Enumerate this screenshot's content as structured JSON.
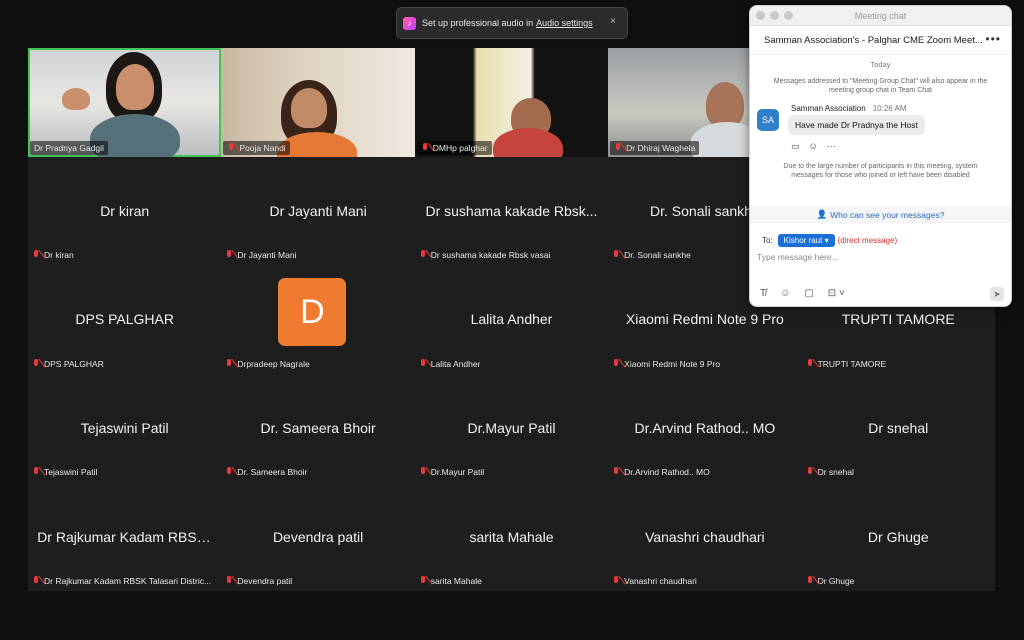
{
  "toast": {
    "icon": "music-note-icon",
    "text": "Set up professional audio in",
    "link": "Audio settings",
    "close": "×"
  },
  "gallery": {
    "tiles": [
      {
        "name": "Dr Pradnya Gadgil",
        "video": true,
        "active": true
      },
      {
        "name": "Pooja Nandi",
        "video": true
      },
      {
        "name": "DMHp palghar",
        "video": true
      },
      {
        "name": "Dr Dhiraj Waghela",
        "video": true
      },
      {
        "name": "",
        "hidden": true
      },
      {
        "name": "Dr kiran",
        "display": "Dr kiran"
      },
      {
        "name": "Dr Jayanti Mani",
        "display": "Dr Jayanti Mani"
      },
      {
        "name": "Dr sushama  kakade Rbsk vasai",
        "display": "Dr sushama  kakade Rbsk..."
      },
      {
        "name": "Dr. Sonali sankhe",
        "display": "Dr. Sonali sankhe"
      },
      {
        "name": "",
        "hidden": true
      },
      {
        "name": "DPS PALGHAR",
        "display": "DPS PALGHAR"
      },
      {
        "name": "Drpradeep Nagrale",
        "avatar": "D"
      },
      {
        "name": "Lalita Andher",
        "display": "Lalita Andher"
      },
      {
        "name": "Xiaomi Redmi Note 9 Pro",
        "display": "Xiaomi Redmi Note 9 Pro"
      },
      {
        "name": "TRUPTI TAMORE",
        "display": "TRUPTI TAMORE"
      },
      {
        "name": "Tejaswini Patil",
        "display": "Tejaswini Patil"
      },
      {
        "name": "Dr. Sameera Bhoir",
        "display": "Dr. Sameera Bhoir"
      },
      {
        "name": "Dr.Mayur Patil",
        "display": "Dr.Mayur Patil"
      },
      {
        "name": "Dr.Arvind Rathod.. MO",
        "display": "Dr.Arvind Rathod.. MO"
      },
      {
        "name": "Dr snehal",
        "display": "Dr snehal"
      },
      {
        "name": "Dr Rajkumar Kadam RBSK Talasari Distric...",
        "display": "Dr Rajkumar Kadam RBSK..."
      },
      {
        "name": "Devendra patil",
        "display": "Devendra patil"
      },
      {
        "name": "sarita Mahale",
        "display": "sarita Mahale"
      },
      {
        "name": "Vanashri chaudhari",
        "display": "Vanashri chaudhari"
      },
      {
        "name": "Dr Ghuge",
        "display": "Dr Ghuge"
      }
    ]
  },
  "chat": {
    "window_title": "Meeting chat",
    "header": "Samman Association's - Palghar CME Zoom Meet...",
    "more": "•••",
    "date_divider": "Today",
    "system_message": "Messages addressed to \"Meeting Group Chat\" will also appear in the meeting group chat in Team Chat",
    "message": {
      "avatar": "SA",
      "sender": "Samman Association",
      "time": "10:26 AM",
      "text": "Have made Dr Pradnya the Host"
    },
    "notice": "Due to the large number of participants in this meeting, system messages for those who joined or left have been disabled",
    "who_can_see": "Who can see your messages?",
    "to_label": "To:",
    "recipient": "Kishor raut",
    "direct": "(direct message)",
    "placeholder": "Type message here...",
    "icons": [
      "format-icon",
      "emoji-icon",
      "file-icon",
      "screenshot-icon",
      "send-icon"
    ]
  }
}
